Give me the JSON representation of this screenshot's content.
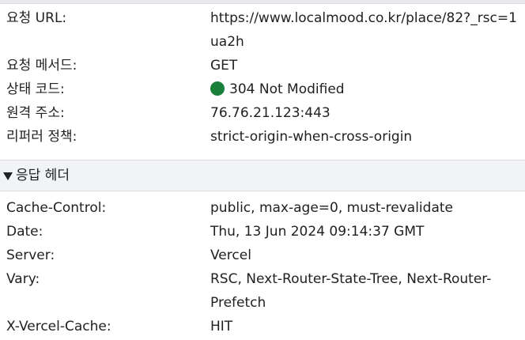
{
  "general": {
    "rows": [
      {
        "key": "요청 URL:",
        "value": "https://www.localmood.co.kr/place/82?_rsc=1ua2h"
      },
      {
        "key": "요청 메서드:",
        "value": "GET"
      },
      {
        "key": "상태 코드:",
        "value": "304 Not Modified",
        "status_color": "#188038"
      },
      {
        "key": "원격 주소:",
        "value": "76.76.21.123:443"
      },
      {
        "key": "리퍼러 정책:",
        "value": "strict-origin-when-cross-origin"
      }
    ]
  },
  "response_headers": {
    "title": "응답 헤더",
    "expanded": true,
    "rows": [
      {
        "key": "Cache-Control:",
        "value": "public, max-age=0, must-revalidate"
      },
      {
        "key": "Date:",
        "value": "Thu, 13 Jun 2024 09:14:37 GMT"
      },
      {
        "key": "Server:",
        "value": "Vercel"
      },
      {
        "key": "Vary:",
        "value": "RSC, Next-Router-State-Tree, Next-Router-Prefetch"
      },
      {
        "key": "X-Vercel-Cache:",
        "value": "HIT"
      }
    ]
  }
}
